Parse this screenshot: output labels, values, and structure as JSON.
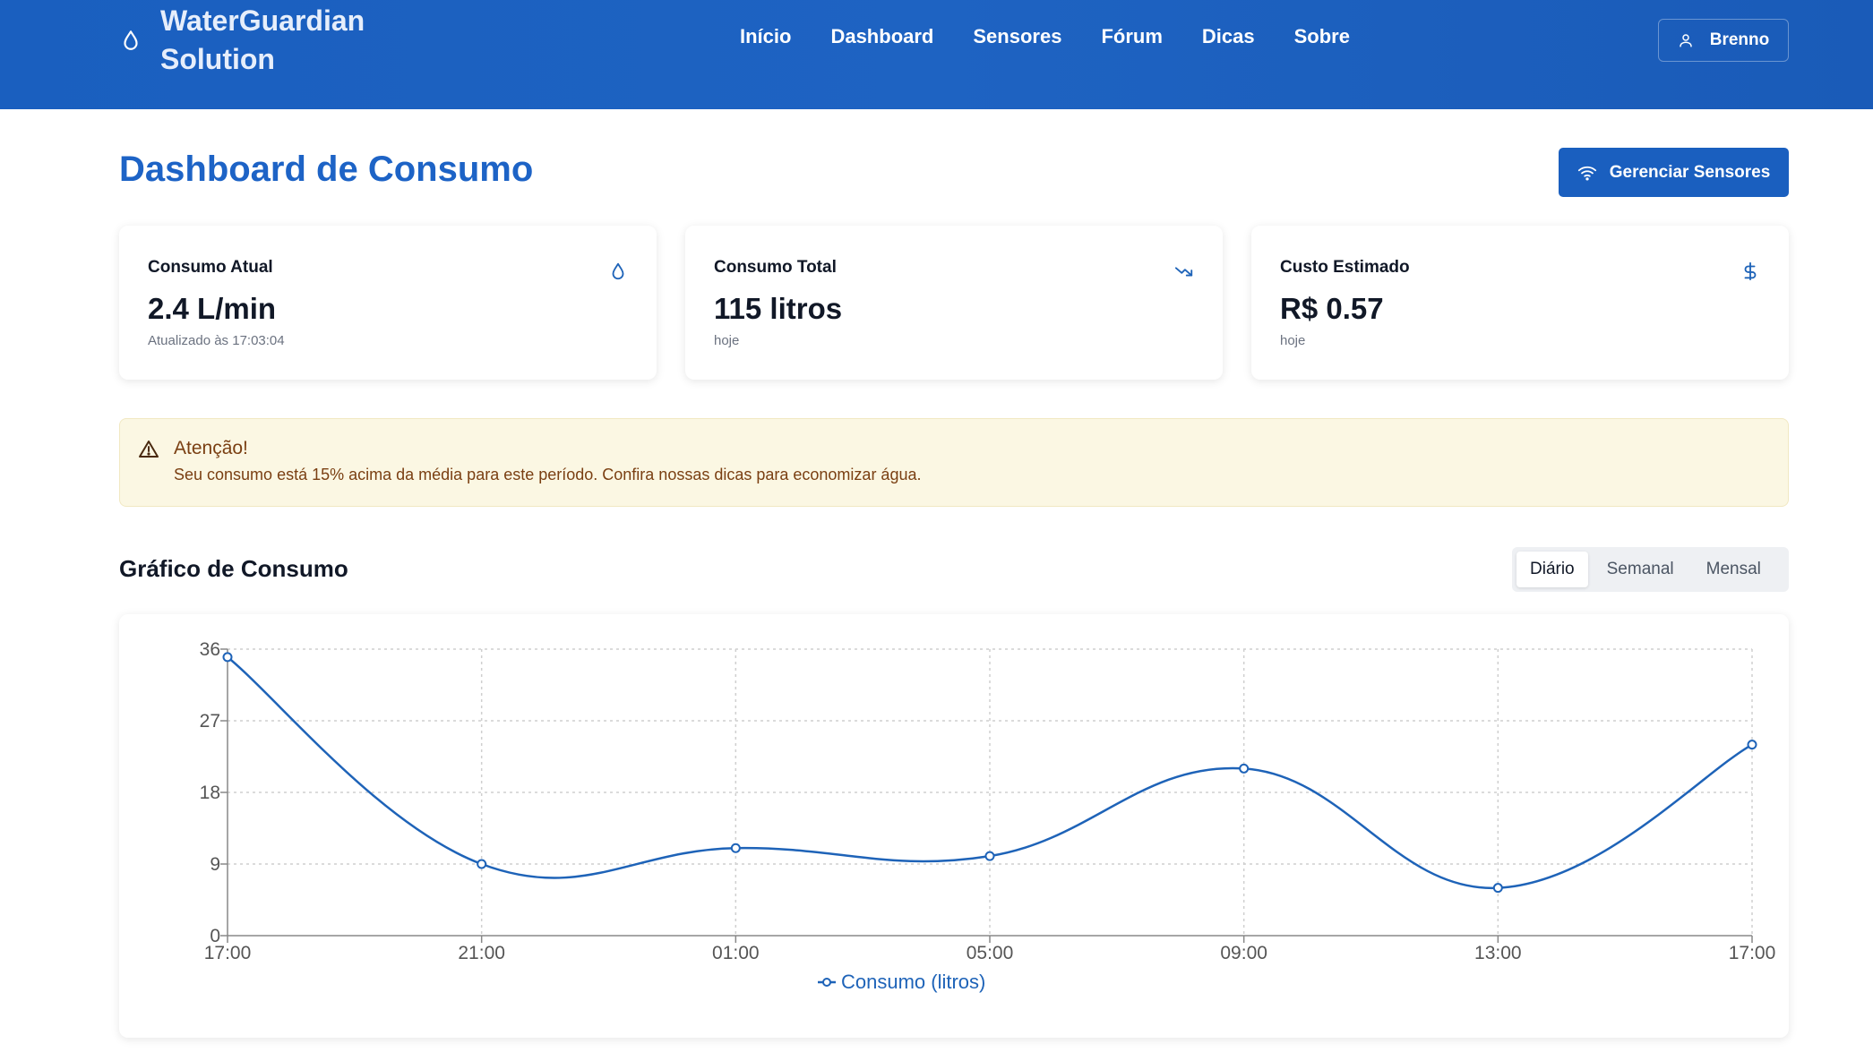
{
  "header": {
    "brand_line1": "WaterGuardian",
    "brand_line2": "Solution",
    "nav": [
      "Início",
      "Dashboard",
      "Sensores",
      "Fórum",
      "Dicas",
      "Sobre"
    ],
    "user_name": "Brenno",
    "icons": {
      "brand": "water-drop-icon",
      "user": "user-icon"
    }
  },
  "page": {
    "title": "Dashboard de Consumo",
    "manage_button": "Gerenciar Sensores"
  },
  "cards": [
    {
      "label": "Consumo Atual",
      "value": "2.4 L/min",
      "sub": "Atualizado às 17:03:04",
      "icon": "water-drop-icon"
    },
    {
      "label": "Consumo Total",
      "value": "115 litros",
      "sub": "hoje",
      "icon": "trending-down-icon"
    },
    {
      "label": "Custo Estimado",
      "value": "R$ 0.57",
      "sub": "hoje",
      "icon": "dollar-icon"
    }
  ],
  "alert": {
    "title": "Atenção!",
    "text": "Seu consumo está 15% acima da média para este período. Confira nossas dicas para economizar água."
  },
  "chart_section": {
    "title": "Gráfico de Consumo",
    "tabs": [
      "Diário",
      "Semanal",
      "Mensal"
    ],
    "active_tab": "Diário"
  },
  "colors": {
    "primary": "#1a5fbf",
    "title": "#1d63c6",
    "line": "#1e63b8",
    "alert_bg": "#fbf7e3",
    "alert_text": "#7a3f12"
  },
  "chart_data": {
    "type": "line",
    "categories": [
      "17:00",
      "21:00",
      "01:00",
      "05:00",
      "09:00",
      "13:00",
      "17:00"
    ],
    "series": [
      {
        "name": "Consumo (litros)",
        "values": [
          35,
          9,
          11,
          10,
          21,
          6,
          24
        ]
      }
    ],
    "yticks": [
      0,
      9,
      18,
      27,
      36
    ],
    "ylim": [
      0,
      36
    ],
    "grid": true,
    "legend": "bottom-center"
  }
}
